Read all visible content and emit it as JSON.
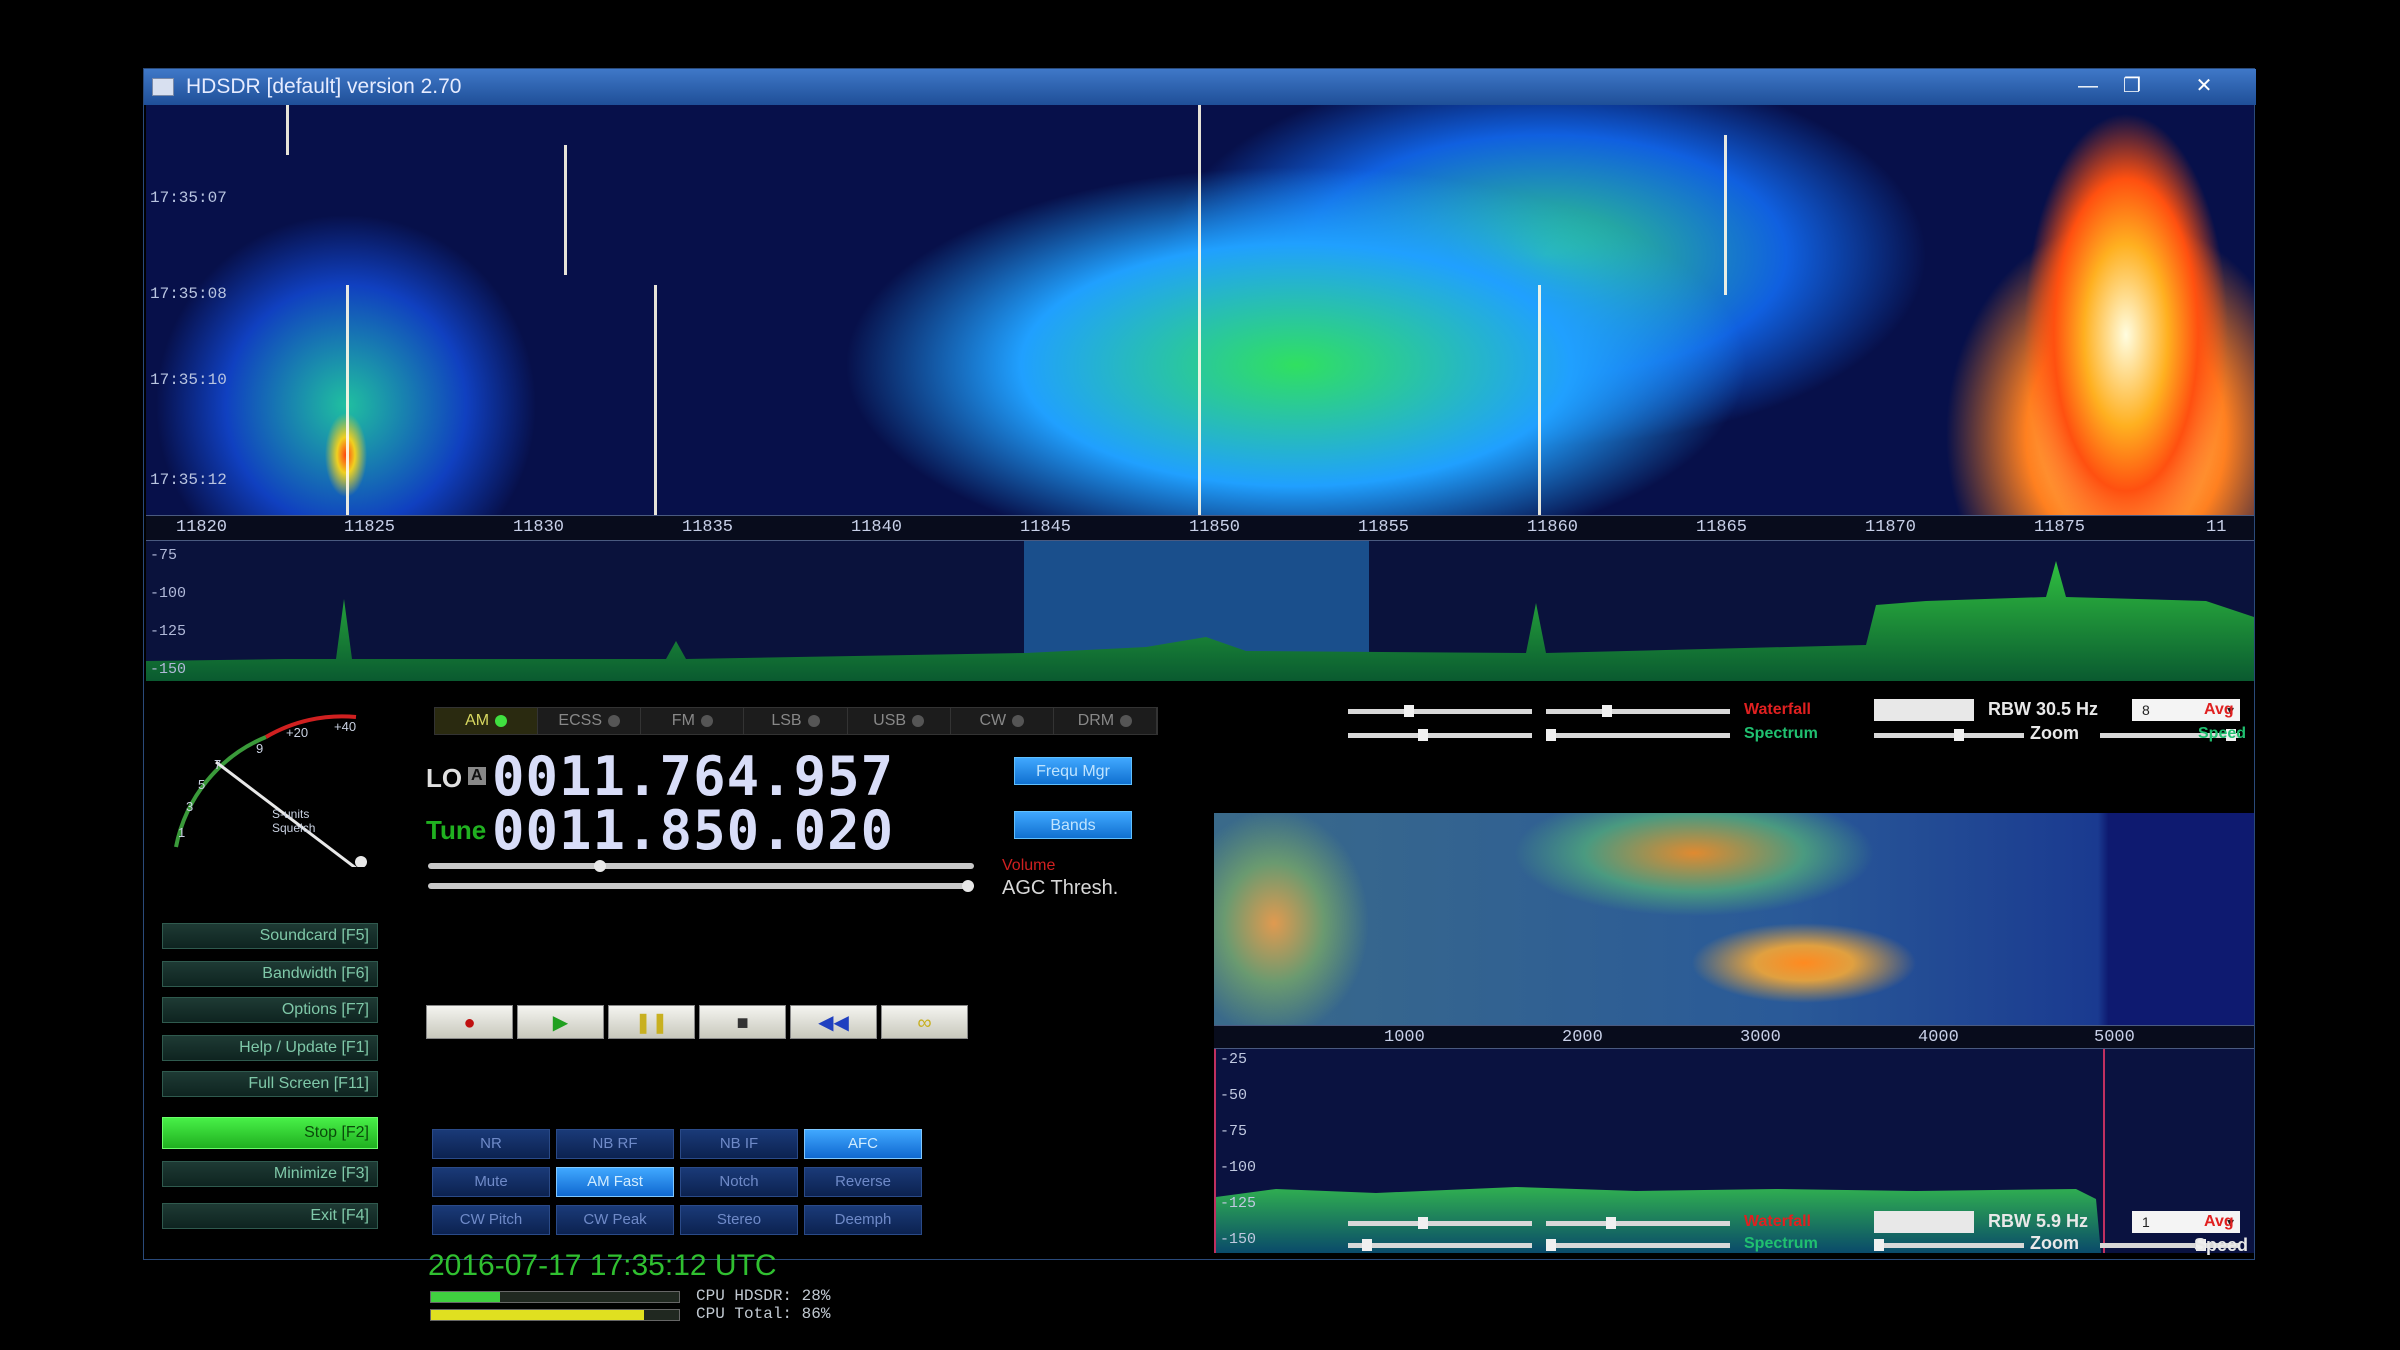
{
  "window": {
    "title": "HDSDR [default]  version 2.70",
    "controls": {
      "minimize": "—",
      "maximize": "❐",
      "close": "✕"
    }
  },
  "waterfall": {
    "timestamps": [
      "17:35:07",
      "17:35:08",
      "17:35:10",
      "17:35:12"
    ],
    "freq_labels": [
      "11820",
      "11825",
      "11830",
      "11835",
      "11840",
      "11845",
      "11850",
      "11855",
      "11860",
      "11865",
      "11870",
      "11875",
      "11"
    ]
  },
  "spectrum": {
    "db_labels": [
      "-75",
      "-100",
      "-125",
      "-150"
    ]
  },
  "smeter": {
    "scale": [
      "1",
      "3",
      "5",
      "7",
      "9",
      "+20",
      "+40"
    ],
    "caption": "S-units\nSquelch"
  },
  "menu": [
    {
      "label": "Soundcard  [F5]",
      "active": false
    },
    {
      "label": "Bandwidth  [F6]",
      "active": false
    },
    {
      "label": "Options  [F7]",
      "active": false
    },
    {
      "label": "Help / Update  [F1]",
      "active": false
    },
    {
      "label": "Full Screen  [F11]",
      "active": false
    },
    {
      "label": "Stop  [F2]",
      "active": true
    },
    {
      "label": "Minimize  [F3]",
      "active": false
    },
    {
      "label": "Exit  [F4]",
      "active": false
    }
  ],
  "modes": [
    {
      "label": "AM",
      "active": true
    },
    {
      "label": "ECSS",
      "active": false
    },
    {
      "label": "FM",
      "active": false
    },
    {
      "label": "LSB",
      "active": false
    },
    {
      "label": "USB",
      "active": false
    },
    {
      "label": "CW",
      "active": false
    },
    {
      "label": "DRM",
      "active": false
    }
  ],
  "lo": {
    "label": "LO",
    "sub": "A",
    "value": "0011.764.957",
    "btn": "Frequ Mgr"
  },
  "tune": {
    "label": "Tune",
    "value": "0011.850.020",
    "btn": "Bands"
  },
  "agc": {
    "volume_label": "Volume",
    "thresh_label": "AGC Thresh."
  },
  "transport": [
    "●",
    "▶",
    "❚❚",
    "■",
    "◀◀",
    "∞"
  ],
  "dsp": [
    {
      "label": "NR",
      "active": false
    },
    {
      "label": "NB RF",
      "active": false
    },
    {
      "label": "NB IF",
      "active": false
    },
    {
      "label": "AFC",
      "active": true
    },
    {
      "label": "Mute",
      "active": false
    },
    {
      "label": "AM Fast",
      "active": true
    },
    {
      "label": "Notch",
      "active": false
    },
    {
      "label": "Reverse",
      "active": false
    },
    {
      "label": "CW Pitch",
      "active": false
    },
    {
      "label": "CW Peak",
      "active": false
    },
    {
      "label": "Stereo",
      "active": false
    },
    {
      "label": "Deemph",
      "active": false
    }
  ],
  "status": {
    "datetime": "2016-07-17   17:35:12 UTC",
    "cpu_hdsdr": "CPU HDSDR:  28%",
    "cpu_total": "CPU Total:  86%",
    "cpu_hdsdr_pct": 28,
    "cpu_total_pct": 86
  },
  "rf_controls": {
    "waterfall_label": "Waterfall",
    "spectrum_label": "Spectrum",
    "zoom_label": "Zoom",
    "rbw": "RBW  30.5 Hz",
    "combo": "8",
    "avg_label": "Avg",
    "speed_label": "Speed"
  },
  "af_axis": [
    "1000",
    "2000",
    "3000",
    "4000",
    "5000"
  ],
  "af_spec": {
    "db_labels": [
      "-25",
      "-50",
      "-75",
      "-100",
      "-125",
      "-150"
    ]
  },
  "af_controls": {
    "waterfall_label": "Waterfall",
    "spectrum_label": "Spectrum",
    "zoom_label": "Zoom",
    "rbw": "RBW  5.9 Hz",
    "combo": "1",
    "avg_label": "Avg",
    "speed_label": "Speed"
  },
  "colors": {
    "accent_blue": "#40a8ff",
    "stop_green": "#48f048",
    "datetime_green": "#30c030",
    "label_red": "#e02020"
  }
}
